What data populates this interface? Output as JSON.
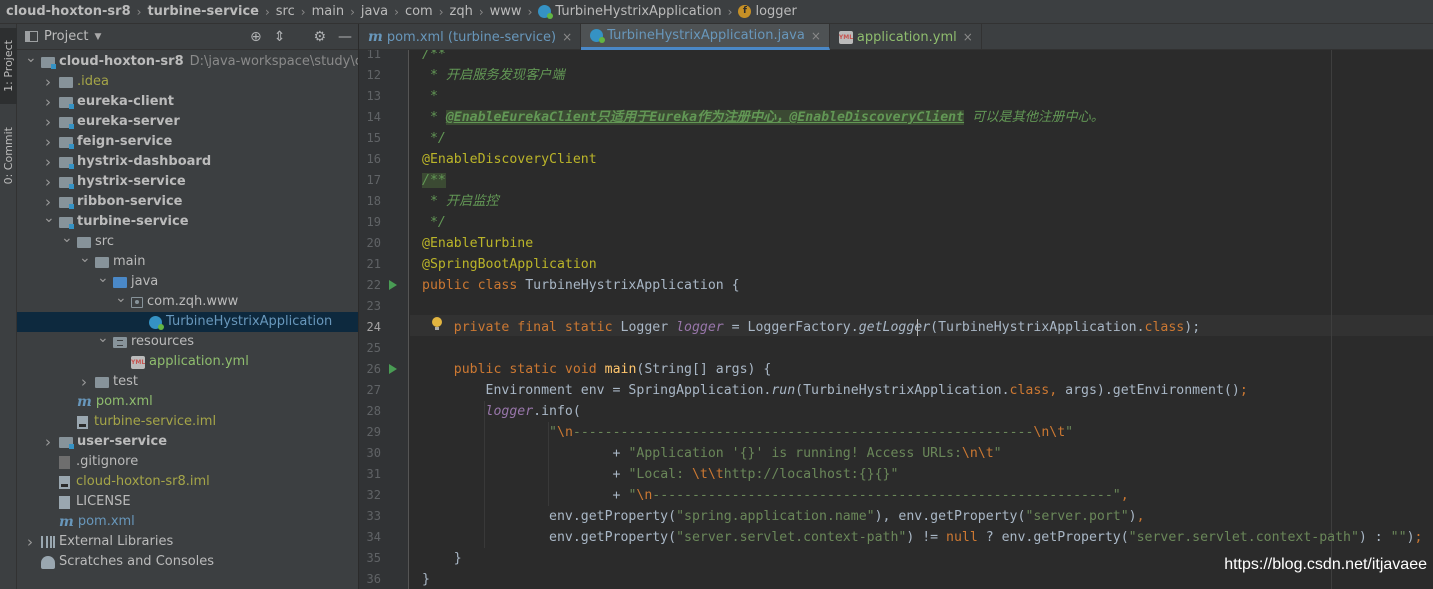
{
  "breadcrumb": {
    "items": [
      {
        "label": "cloud-hoxton-sr8",
        "bold": true
      },
      {
        "label": "turbine-service",
        "bold": true
      },
      {
        "label": "src"
      },
      {
        "label": "main"
      },
      {
        "label": "java"
      },
      {
        "label": "com"
      },
      {
        "label": "zqh"
      },
      {
        "label": "www"
      },
      {
        "label": "TurbineHystrixApplication",
        "icon": "class-icon"
      },
      {
        "label": "logger",
        "icon": "field-icon"
      }
    ]
  },
  "left_stripe": {
    "project_tab": "1: Project",
    "commit_tab": "0: Commit"
  },
  "project_panel": {
    "title": "Project",
    "tree": [
      {
        "label": "cloud-hoxton-sr8",
        "path": "D:\\java-workspace\\study\\cloud-",
        "level": 0,
        "arrow": "down",
        "icon": "module",
        "style": "bold"
      },
      {
        "label": ".idea",
        "level": 1,
        "arrow": "right",
        "icon": "folder",
        "style": "olive"
      },
      {
        "label": "eureka-client",
        "level": 1,
        "arrow": "right",
        "icon": "module",
        "style": "bold"
      },
      {
        "label": "eureka-server",
        "level": 1,
        "arrow": "right",
        "icon": "module",
        "style": "bold"
      },
      {
        "label": "feign-service",
        "level": 1,
        "arrow": "right",
        "icon": "module",
        "style": "bold"
      },
      {
        "label": "hystrix-dashboard",
        "level": 1,
        "arrow": "right",
        "icon": "module",
        "style": "bold"
      },
      {
        "label": "hystrix-service",
        "level": 1,
        "arrow": "right",
        "icon": "module",
        "style": "bold"
      },
      {
        "label": "ribbon-service",
        "level": 1,
        "arrow": "right",
        "icon": "module",
        "style": "bold"
      },
      {
        "label": "turbine-service",
        "level": 1,
        "arrow": "down",
        "icon": "module",
        "style": "bold"
      },
      {
        "label": "src",
        "level": 2,
        "arrow": "down",
        "icon": "folder",
        "style": ""
      },
      {
        "label": "main",
        "level": 3,
        "arrow": "down",
        "icon": "folder",
        "style": ""
      },
      {
        "label": "java",
        "level": 4,
        "arrow": "down",
        "icon": "source-folder",
        "style": ""
      },
      {
        "label": "com.zqh.www",
        "level": 5,
        "arrow": "down",
        "icon": "package",
        "style": ""
      },
      {
        "label": "TurbineHystrixApplication",
        "level": 6,
        "arrow": "",
        "icon": "class",
        "style": "",
        "selected": true
      },
      {
        "label": "resources",
        "level": 4,
        "arrow": "down",
        "icon": "resources-folder",
        "style": ""
      },
      {
        "label": "application.yml",
        "level": 5,
        "arrow": "",
        "icon": "yml",
        "style": "green"
      },
      {
        "label": "test",
        "level": 3,
        "arrow": "right",
        "icon": "folder",
        "style": ""
      },
      {
        "label": "pom.xml",
        "level": 2,
        "arrow": "",
        "icon": "maven",
        "style": "green"
      },
      {
        "label": "turbine-service.iml",
        "level": 2,
        "arrow": "",
        "icon": "iml",
        "style": "olive"
      },
      {
        "label": "user-service",
        "level": 1,
        "arrow": "right",
        "icon": "module",
        "style": "bold"
      },
      {
        "label": ".gitignore",
        "level": 1,
        "arrow": "",
        "icon": "file-dark",
        "style": ""
      },
      {
        "label": "cloud-hoxton-sr8.iml",
        "level": 1,
        "arrow": "",
        "icon": "iml",
        "style": "olive"
      },
      {
        "label": "LICENSE",
        "level": 1,
        "arrow": "",
        "icon": "file",
        "style": ""
      },
      {
        "label": "pom.xml",
        "level": 1,
        "arrow": "",
        "icon": "maven",
        "style": "blue"
      },
      {
        "label": "External Libraries",
        "level": 0,
        "arrow": "right",
        "icon": "libraries",
        "style": ""
      },
      {
        "label": "Scratches and Consoles",
        "level": 0,
        "arrow": "",
        "icon": "scratches",
        "style": ""
      }
    ]
  },
  "tabs": [
    {
      "label": "pom.xml (turbine-service)",
      "icon": "maven-icon",
      "active": false,
      "color": "blue"
    },
    {
      "label": "TurbineHystrixApplication.java",
      "icon": "class-icon",
      "active": true,
      "color": "blue"
    },
    {
      "label": "application.yml",
      "icon": "yml-icon",
      "active": false,
      "color": "green"
    }
  ],
  "editor": {
    "current_line": 24,
    "lines": [
      {
        "n": "11",
        "tokens": [
          [
            "cmt",
            "/**"
          ]
        ]
      },
      {
        "n": "12",
        "tokens": [
          [
            "cmt",
            " * 开启服务发现客户端"
          ]
        ]
      },
      {
        "n": "13",
        "tokens": [
          [
            "cmt",
            " *"
          ]
        ]
      },
      {
        "n": "14",
        "tokens": [
          [
            "cmt",
            " * "
          ],
          [
            "cmt-tag",
            "@EnableEurekaClient只适用于Eureka作为注册中心，@EnableDiscoveryClient"
          ],
          [
            "cmt",
            " 可以是其他注册中心。"
          ]
        ]
      },
      {
        "n": "15",
        "tokens": [
          [
            "cmt",
            " */"
          ]
        ]
      },
      {
        "n": "16",
        "tokens": [
          [
            "ann",
            "@EnableDiscoveryClient"
          ]
        ]
      },
      {
        "n": "17",
        "tokens": [
          [
            "cmt cmt-hl",
            "/**"
          ]
        ]
      },
      {
        "n": "18",
        "tokens": [
          [
            "cmt",
            " * 开启监控"
          ]
        ]
      },
      {
        "n": "19",
        "tokens": [
          [
            "cmt",
            " */"
          ]
        ]
      },
      {
        "n": "20",
        "tokens": [
          [
            "ann",
            "@EnableTurbine"
          ]
        ]
      },
      {
        "n": "21",
        "tokens": [
          [
            "ann",
            "@SpringBootApplication"
          ]
        ]
      },
      {
        "n": "22",
        "run": true,
        "tokens": [
          [
            "kw",
            "public class "
          ],
          [
            "",
            "TurbineHystrixApplication {"
          ]
        ]
      },
      {
        "n": "23",
        "tokens": []
      },
      {
        "n": "24",
        "tokens": [
          [
            "",
            "    "
          ],
          [
            "kw",
            "private final static "
          ],
          [
            "",
            "Logger "
          ],
          [
            "fld",
            "logger"
          ],
          [
            "",
            " = LoggerFactory."
          ],
          [
            "mcall",
            "getLogger"
          ],
          [
            "",
            "(TurbineHystrixApplication."
          ],
          [
            "kw",
            "class"
          ],
          [
            "",
            ");"
          ]
        ]
      },
      {
        "n": "25",
        "tokens": []
      },
      {
        "n": "26",
        "run": true,
        "tokens": [
          [
            "",
            "    "
          ],
          [
            "kw",
            "public static void "
          ],
          [
            "fn",
            "main"
          ],
          [
            "",
            "(String[] args) {"
          ]
        ]
      },
      {
        "n": "27",
        "tokens": [
          [
            "",
            "        Environment env = SpringApplication."
          ],
          [
            "mcall",
            "run"
          ],
          [
            "",
            "(TurbineHystrixApplication."
          ],
          [
            "kw",
            "class"
          ],
          [
            "kw",
            ", "
          ],
          [
            "",
            "args).getEnvironment()"
          ],
          [
            "kw",
            ";"
          ]
        ]
      },
      {
        "n": "28",
        "tokens": [
          [
            "",
            "        "
          ],
          [
            "fld",
            "logger"
          ],
          [
            "",
            ".info("
          ]
        ]
      },
      {
        "n": "29",
        "tokens": [
          [
            "",
            "                "
          ],
          [
            "str",
            "\""
          ],
          [
            "esc",
            "\\n"
          ],
          [
            "str",
            "----------------------------------------------------------"
          ],
          [
            "esc",
            "\\n\\t"
          ],
          [
            "str",
            "\""
          ]
        ]
      },
      {
        "n": "30",
        "tokens": [
          [
            "",
            "                        + "
          ],
          [
            "str",
            "\"Application '{}' is running! Access URLs:"
          ],
          [
            "esc",
            "\\n\\t"
          ],
          [
            "str",
            "\""
          ]
        ]
      },
      {
        "n": "31",
        "tokens": [
          [
            "",
            "                        + "
          ],
          [
            "str",
            "\"Local: "
          ],
          [
            "esc",
            "\\t\\t"
          ],
          [
            "str",
            "http://localhost:{}{}\""
          ]
        ]
      },
      {
        "n": "32",
        "tokens": [
          [
            "",
            "                        + "
          ],
          [
            "str",
            "\""
          ],
          [
            "esc",
            "\\n"
          ],
          [
            "str",
            "----------------------------------------------------------\""
          ],
          [
            "kw",
            ","
          ]
        ]
      },
      {
        "n": "33",
        "tokens": [
          [
            "",
            "                env.getProperty("
          ],
          [
            "str",
            "\"spring.application.name\""
          ],
          [
            "",
            "), env.getProperty("
          ],
          [
            "str",
            "\"server.port\""
          ],
          [
            "",
            ")"
          ],
          [
            "kw",
            ","
          ]
        ]
      },
      {
        "n": "34",
        "tokens": [
          [
            "",
            "                env.getProperty("
          ],
          [
            "str",
            "\"server.servlet.context-path\""
          ],
          [
            "",
            ") != "
          ],
          [
            "kw",
            "null "
          ],
          [
            "",
            "? env.getProperty("
          ],
          [
            "str",
            "\"server.servlet.context-path\""
          ],
          [
            "",
            ") : "
          ],
          [
            "str",
            "\"\""
          ],
          [
            "",
            ")"
          ],
          [
            "kw",
            ";"
          ]
        ]
      },
      {
        "n": "35",
        "tokens": [
          [
            "",
            "    }"
          ]
        ]
      },
      {
        "n": "36",
        "tokens": [
          [
            "",
            "}"
          ]
        ]
      }
    ]
  },
  "watermark": "https://blog.csdn.net/itjavaee",
  "colors": {
    "keyword": "#cc7832",
    "annotation": "#bbb529",
    "comment": "#629755",
    "string": "#6a8759",
    "field": "#9876aa",
    "method_decl": "#ffc66d",
    "text": "#a9b7c6",
    "selection": "#0d293e"
  }
}
